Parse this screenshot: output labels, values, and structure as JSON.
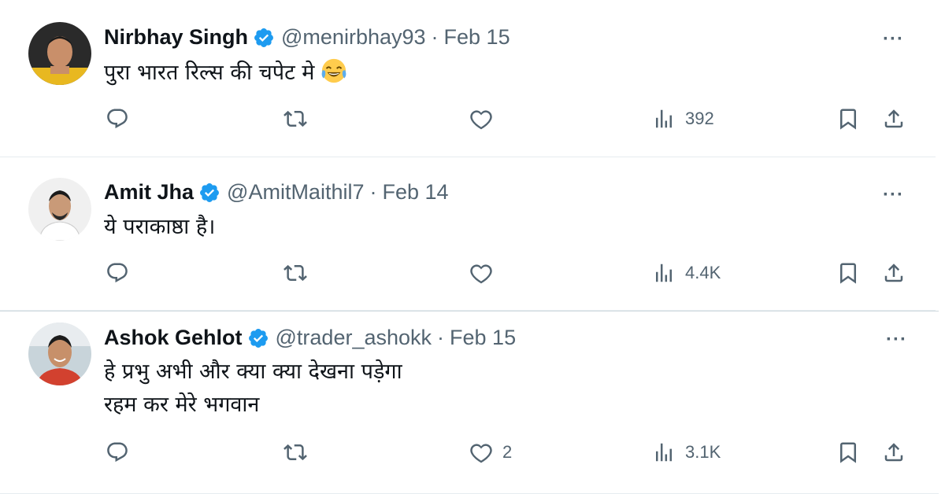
{
  "tweets": [
    {
      "name": "Nirbhay Singh",
      "handle": "@menirbhay93",
      "separator": "·",
      "date": "Feb 15",
      "text_lines": [
        "पुरा भारत रिल्स की चपेट मे"
      ],
      "emoji": "face-with-tears-of-joy",
      "more": "···",
      "likes": "",
      "views": "392",
      "avatar_bg": "#2b2b2b"
    },
    {
      "name": "Amit Jha",
      "handle": "@AmitMaithil7",
      "separator": "·",
      "date": "Feb 14",
      "text_lines": [
        "ये पराकाष्ठा है।"
      ],
      "more": "···",
      "likes": "",
      "views": "4.4K",
      "avatar_bg": "#f2f2f2"
    },
    {
      "name": "Ashok Gehlot",
      "handle": "@trader_ashokk",
      "separator": "·",
      "date": "Feb 15",
      "text_lines": [
        "हे प्रभु अभी और क्या क्या देखना पड़ेगा",
        "रहम कर मेरे भगवान"
      ],
      "more": "···",
      "likes": "2",
      "views": "3.1K",
      "avatar_bg": "#c9d6dc"
    }
  ],
  "colors": {
    "text": "#0f1419",
    "muted": "#536471",
    "verified": "#1d9bf0",
    "divider": "#e6ecf0"
  }
}
